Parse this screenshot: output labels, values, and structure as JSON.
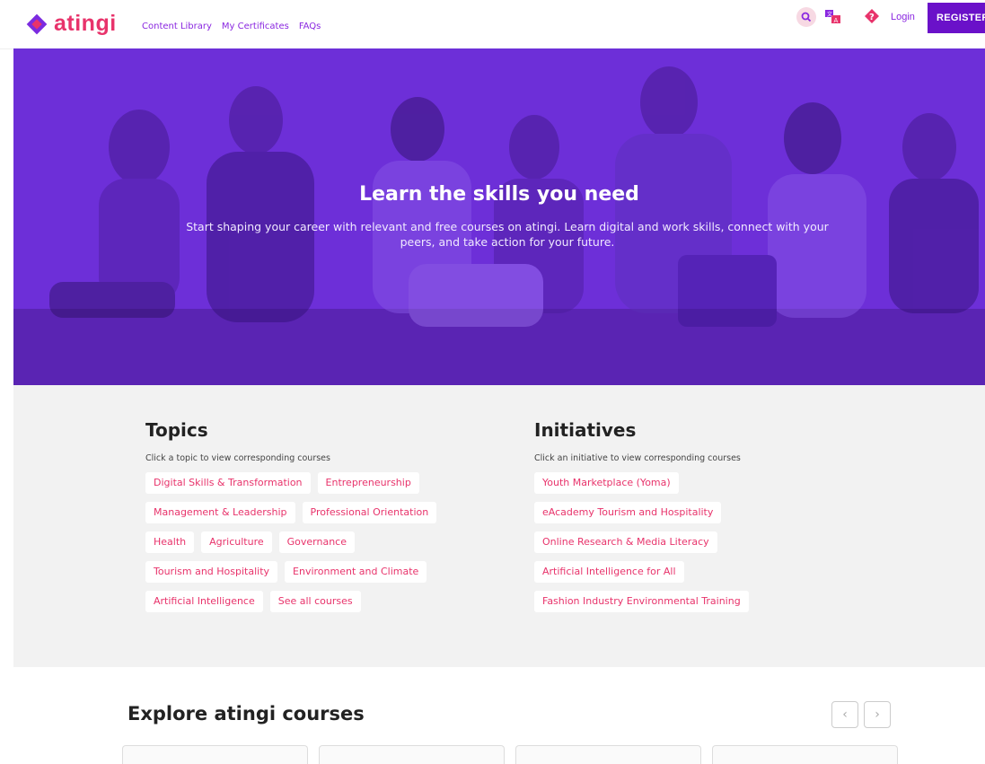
{
  "brand": {
    "name": "atingi",
    "color": "#e8336b"
  },
  "nav": {
    "links": [
      "Content Library",
      "My Certificates",
      "FAQs"
    ],
    "login": "Login",
    "register": "REGISTER",
    "icons": [
      "search-icon",
      "translate-icon",
      "help-icon"
    ]
  },
  "hero": {
    "title": "Learn the skills you need",
    "subtitle": "Start shaping your career with relevant and free courses on atingi. Learn digital and work skills, connect with your peers, and take action for your future."
  },
  "topics": {
    "title": "Topics",
    "description": "Click a topic to view corresponding courses",
    "rows": [
      [
        "Digital Skills & Transformation",
        "Entrepreneurship"
      ],
      [
        "Management & Leadership",
        "Professional Orientation"
      ],
      [
        "Health",
        "Agriculture",
        "Governance"
      ],
      [
        "Tourism and Hospitality",
        "Environment and Climate"
      ],
      [
        "Artificial Intelligence",
        "See all courses"
      ]
    ]
  },
  "initiatives": {
    "title": "Initiatives",
    "description": "Click an initiative to view corresponding courses",
    "items": [
      "Youth Marketplace (Yoma)",
      "eAcademy Tourism and Hospitality",
      "Online Research & Media Literacy",
      "Artificial Intelligence for All",
      "Fashion Industry Environmental Training"
    ]
  },
  "explore": {
    "title": "Explore atingi courses",
    "prev": "‹",
    "next": "›"
  },
  "colors": {
    "accent": "#8a27e0",
    "register_bg": "#6a11c9",
    "chip_text": "#e8336b",
    "hero_overlay": "#6d2fd8"
  }
}
